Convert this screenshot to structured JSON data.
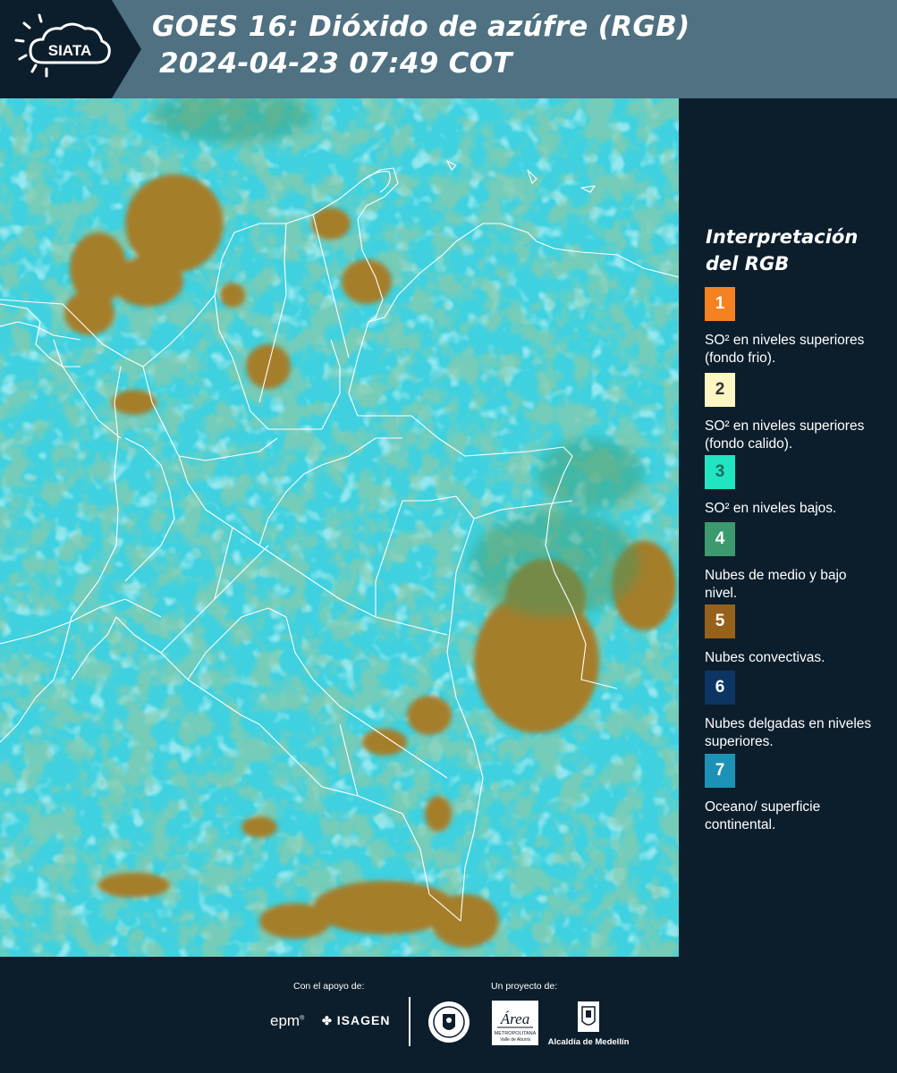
{
  "header": {
    "logo_text": "SIATA",
    "title_line1": "GOES 16: Dióxido de azúfre (RGB)",
    "title_line2": "2024-04-23 07:49 COT",
    "colors": {
      "bar": "#4f7182",
      "logo_bg": "#0c1e2c"
    }
  },
  "map": {
    "description_colors": {
      "background": "#3fd2e0",
      "convective": "#a57e2c",
      "midlow": "#3e9a6b"
    }
  },
  "legend": {
    "title": "Interpretación\ndel RGB",
    "items": [
      {
        "number": "1",
        "color": "#f58220",
        "text_color": "#ffffff",
        "label": "SO² en niveles superiores (fondo frio)."
      },
      {
        "number": "2",
        "color": "#fcf6c3",
        "text_color": "#333333",
        "label": "SO² en niveles superiores (fondo calido)."
      },
      {
        "number": "3",
        "color": "#21e5c0",
        "text_color": "#1a6b60",
        "label": "SO² en niveles bajos."
      },
      {
        "number": "4",
        "color": "#3c9a6e",
        "text_color": "#ffffff",
        "label": "Nubes de medio y bajo nivel."
      },
      {
        "number": "5",
        "color": "#96621b",
        "text_color": "#ffffff",
        "label": "Nubes convectivas."
      },
      {
        "number": "6",
        "color": "#0c3563",
        "text_color": "#ffffff",
        "label": "Nubes delgadas en niveles superiores."
      },
      {
        "number": "7",
        "color": "#1d92b7",
        "text_color": "#ffffff",
        "label": "Oceano/ superficie continental."
      }
    ]
  },
  "footer": {
    "support_label": "Con el apoyo de:",
    "project_label": "Un proyecto de:",
    "epm": "epm",
    "isagen": "ISAGEN",
    "area_text": "Área",
    "area_sub": "METROPOLITANA",
    "area_sub2": "Valle de Aburrá",
    "alcaldia": "Alcaldía de Medellín"
  }
}
